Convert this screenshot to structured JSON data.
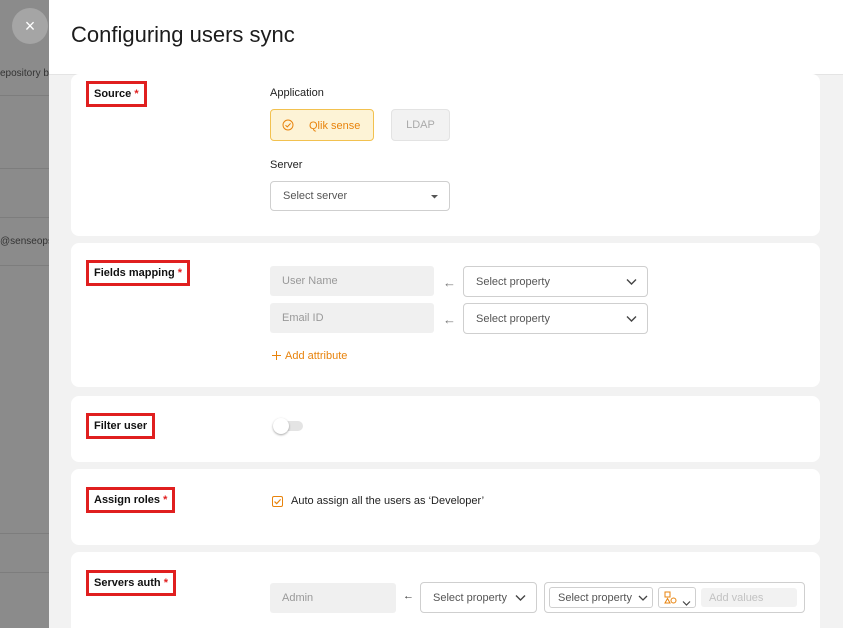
{
  "background": {
    "close_glyph": "×",
    "text_repository": "epository b",
    "text_email": "@senseops"
  },
  "drawer": {
    "title": "Configuring users sync"
  },
  "source": {
    "label": "Source",
    "required_mark": "*",
    "application_label": "Application",
    "apps": [
      {
        "label": "Qlik sense",
        "selected": true
      },
      {
        "label": "LDAP",
        "selected": false
      }
    ],
    "server_label": "Server",
    "server_placeholder": "Select server"
  },
  "fields_mapping": {
    "label": "Fields mapping",
    "required_mark": "*",
    "rows": [
      {
        "field": "User Name",
        "property_placeholder": "Select property"
      },
      {
        "field": "Email ID",
        "property_placeholder": "Select property"
      }
    ],
    "arrow_glyph": "←",
    "add_attribute_label": "Add attribute"
  },
  "filter_user": {
    "label": "Filter user",
    "enabled": false
  },
  "assign_roles": {
    "label": "Assign roles",
    "required_mark": "*",
    "checkbox_label": "Auto assign all the users as ‘Developer’",
    "checked": true
  },
  "servers_auth": {
    "label": "Servers auth",
    "required_mark": "*",
    "field": "Admin",
    "arrow_glyph": "←",
    "property_placeholder": "Select property",
    "inner_property_placeholder": "Select property",
    "add_values_placeholder": "Add values"
  },
  "colors": {
    "accent": "#e8830c",
    "highlight_border": "#e01f1f",
    "chip_bg": "#fdf3d6"
  }
}
